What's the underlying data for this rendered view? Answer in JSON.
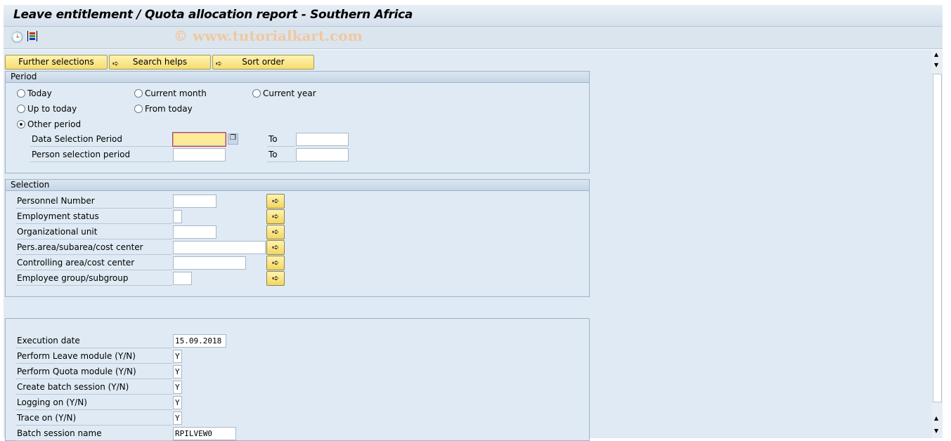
{
  "title": "Leave entitlement / Quota allocation report - Southern Africa",
  "watermark": "© www.tutorialkart.com",
  "toolbar": {
    "icons": [
      "execute-icon",
      "variant-icon"
    ]
  },
  "buttons": {
    "further": "Further selections",
    "search": "Search helps",
    "sort": "Sort order"
  },
  "period": {
    "header": "Period",
    "radios": [
      {
        "label": "Today",
        "selected": false
      },
      {
        "label": "Current month",
        "selected": false
      },
      {
        "label": "Current year",
        "selected": false
      },
      {
        "label": "Up to today",
        "selected": false
      },
      {
        "label": "From today",
        "selected": false
      },
      {
        "label": "Other period",
        "selected": true
      }
    ],
    "rows": [
      {
        "label": "Data Selection Period",
        "from": "",
        "to_label": "To",
        "to": ""
      },
      {
        "label": "Person selection period",
        "from": "",
        "to_label": "To",
        "to": ""
      }
    ]
  },
  "selection": {
    "header": "Selection",
    "rows": [
      {
        "label": "Personnel Number",
        "value": ""
      },
      {
        "label": "Employment status",
        "value": ""
      },
      {
        "label": "Organizational unit",
        "value": ""
      },
      {
        "label": "Pers.area/subarea/cost center",
        "value": ""
      },
      {
        "label": "Controlling area/cost center",
        "value": ""
      },
      {
        "label": "Employee group/subgroup",
        "value": ""
      }
    ]
  },
  "params": {
    "rows": [
      {
        "label": "Execution date",
        "value": "15.09.2018"
      },
      {
        "label": "Perform Leave module (Y/N)",
        "value": "Y"
      },
      {
        "label": "Perform Quota module (Y/N)",
        "value": "Y"
      },
      {
        "label": "Create batch session (Y/N)",
        "value": "Y"
      },
      {
        "label": "Logging on (Y/N)",
        "value": "Y"
      },
      {
        "label": "Trace on (Y/N)",
        "value": "Y"
      },
      {
        "label": "Batch session name",
        "value": "RPILVEW0"
      }
    ]
  },
  "colors": {
    "accent_button": "#f6dc70",
    "background": "#dfeaf4",
    "focus_field": "#fdeb9a"
  }
}
